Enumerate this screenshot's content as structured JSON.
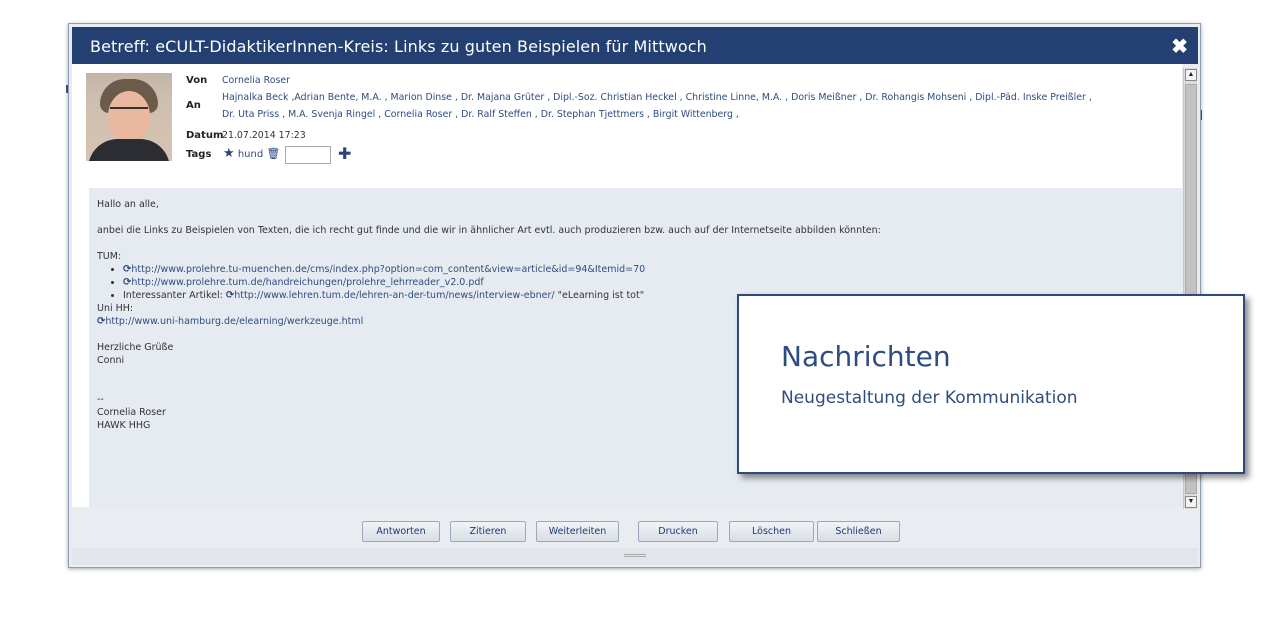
{
  "dialog": {
    "title": "Betreff: eCULT-DidaktikerInnen-Kreis: Links zu guten Beispielen für Mittwoch",
    "close_icon": "close-icon"
  },
  "meta": {
    "von_label": "Von",
    "von_value": "Cornelia Roser",
    "an_label": "An",
    "an_line1": "Hajnalka Beck ,Adrian Bente, M.A. , Marion Dinse , Dr. Majana Grüter , Dipl.-Soz. Christian Heckel , Christine Linne, M.A. , Doris Meißner , Dr. Rohangis Mohseni , Dipl.-Päd. Inske Preißler ,",
    "an_line2": "Dr. Uta Priss , M.A. Svenja Ringel , Cornelia Roser , Dr. Ralf Steffen , Dr. Stephan Tjettmers , Birgit Wittenberg ,",
    "datum_label": "Datum",
    "datum_value": "21.07.2014 17:23",
    "tags_label": "Tags",
    "tag": "hund"
  },
  "body": {
    "greeting": "Hallo an alle,",
    "intro": "anbei die Links zu Beispielen von Texten, die ich recht gut finde und die wir in ähnlicher Art evtl. auch produzieren bzw. auch auf der Internetseite abbilden könnten:",
    "tum_label": "TUM:",
    "link1": "http://www.prolehre.tu-muenchen.de/cms/index.php?option=com_content&view=article&id=94&Itemid=70",
    "link2": "http://www.prolehre.tum.de/handreichungen/prolehre_lehrreader_v2.0.pdf",
    "article_label": "Interessanter Artikel:",
    "link3": "http://www.lehren.tum.de/lehren-an-der-tum/news/interview-ebner/",
    "article_title": "\"eLearning ist tot\"",
    "unihh_label": "Uni HH:",
    "link4": "http://www.uni-hamburg.de/elearning/werkzeuge.html",
    "closing": "Herzliche Grüße",
    "signoff": "Conni",
    "sep": "--",
    "sig_name": "Cornelia Roser",
    "sig_org": "HAWK HHG"
  },
  "buttons": {
    "reply": "Antworten",
    "quote": "Zitieren",
    "forward": "Weiterleiten",
    "print": "Drucken",
    "delete": "Löschen",
    "close": "Schließen"
  },
  "callout": {
    "heading": "Nachrichten",
    "subheading": "Neugestaltung der Kommunikation"
  },
  "colors": {
    "titlebar": "#243f72",
    "link": "#2f4c80",
    "body_bg": "#e6ebf1"
  }
}
